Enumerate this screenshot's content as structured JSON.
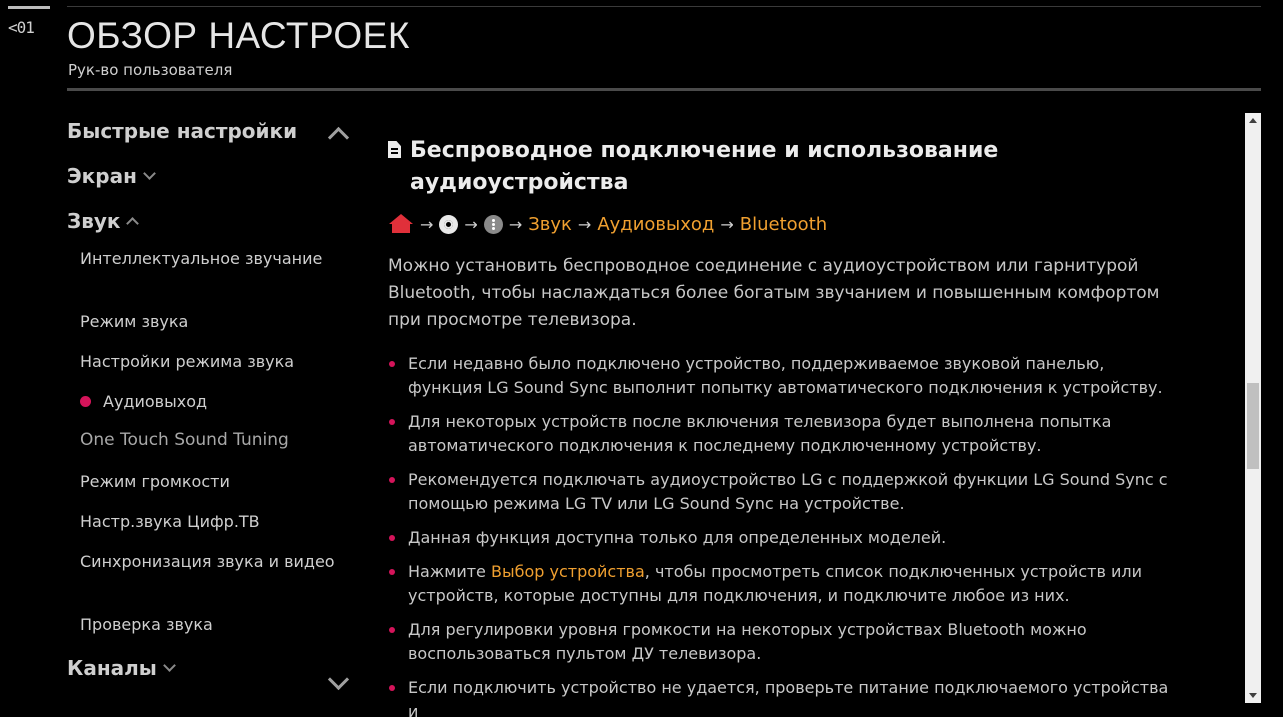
{
  "back": {
    "label": "<01"
  },
  "header": {
    "title": "ОБЗОР НАСТРОЕК",
    "subtitle": "Рук-во пользователя"
  },
  "sidebar": {
    "categories": [
      {
        "label": "Быстрые настройки",
        "expanded": false
      },
      {
        "label": "Экран",
        "expanded": false
      },
      {
        "label": "Звук",
        "expanded": true
      },
      {
        "label": "Каналы",
        "expanded": false
      }
    ],
    "sound_items": [
      "Интеллектуальное звучание",
      "Режим звука",
      "Настройки режима звука",
      "Аудиовыход",
      "One Touch Sound Tuning",
      "Режим громкости",
      "Настр.звука Цифр.ТВ",
      "Синхронизация звука и видео",
      "Проверка звука"
    ],
    "active_item": "Аудиовыход"
  },
  "content": {
    "title": "Беспроводное подключение и использование аудиоустройства",
    "path": {
      "sep": "→",
      "items": [
        "Звук",
        "Аудиовыход",
        "Bluetooth"
      ]
    },
    "intro": "Можно установить беспроводное соединение с аудиоустройством или гарнитурой Bluetooth, чтобы наслаждаться более богатым звучанием и повышенным комфортом при просмотре телевизора.",
    "bullets": [
      "Если недавно было подключено устройство, поддерживаемое звуковой панелью, функция LG Sound Sync выполнит попытку автоматического подключения к устройству.",
      "Для некоторых устройств после включения телевизора будет выполнена попытка автоматического подключения к последнему подключенному устройству.",
      "Рекомендуется подключать аудиоустройство LG с поддержкой функции LG Sound Sync с помощью режима LG TV или LG Sound Sync на устройстве.",
      "Данная функция доступна только для определенных моделей.",
      "Для регулировки уровня громкости на некоторых устройствах Bluetooth можно воспользоваться пультом ДУ телевизора.",
      "Если подключить устройство не удается, проверьте питание подключаемого устройства и"
    ],
    "bullet_select": {
      "prefix": "Нажмите",
      "link": "Выбор устройства",
      "suffix": ", чтобы просмотреть список подключенных устройств или устройств, которые доступны для подключения, и подключите любое из них."
    }
  },
  "colors": {
    "accent": "#d4145a",
    "link": "#f0a030",
    "home": "#e0303a",
    "background": "#000000"
  },
  "icons": [
    "doc-icon",
    "home-icon",
    "gear-icon",
    "more-icon",
    "chevron-up-icon",
    "chevron-down-icon"
  ]
}
